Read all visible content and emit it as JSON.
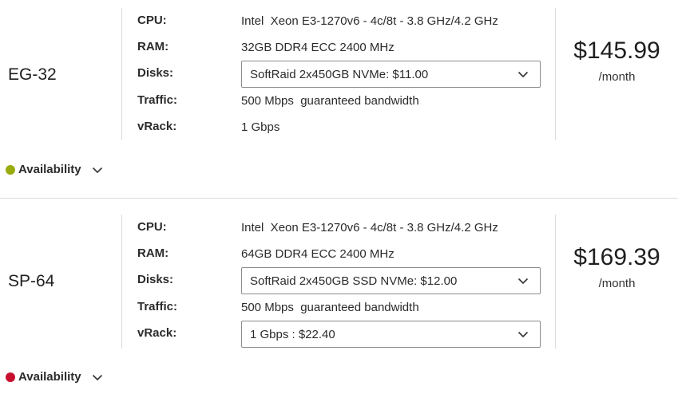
{
  "servers": [
    {
      "name": "EG-32",
      "specs": {
        "cpu_label": "CPU:",
        "cpu_value": "Intel  Xeon E3-1270v6 - 4c/8t - 3.8 GHz/4.2 GHz",
        "ram_label": "RAM:",
        "ram_value": "32GB DDR4 ECC 2400 MHz",
        "disks_label": "Disks:",
        "disks_selected": "SoftRaid 2x450GB NVMe: $11.00",
        "traffic_label": "Traffic:",
        "traffic_value": "500 Mbps  guaranteed bandwidth",
        "vrack_label": "vRack:",
        "vrack_value": "1 Gbps"
      },
      "price": "$145.99",
      "period": "/month",
      "availability_label": "Availability",
      "availability_color": "#9aab0e"
    },
    {
      "name": "SP-64",
      "specs": {
        "cpu_label": "CPU:",
        "cpu_value": "Intel  Xeon E3-1270v6 - 4c/8t - 3.8 GHz/4.2 GHz",
        "ram_label": "RAM:",
        "ram_value": "64GB DDR4 ECC 2400 MHz",
        "disks_label": "Disks:",
        "disks_selected": "SoftRaid 2x450GB SSD NVMe: $12.00",
        "traffic_label": "Traffic:",
        "traffic_value": "500 Mbps  guaranteed bandwidth",
        "vrack_label": "vRack:",
        "vrack_selected": "1 Gbps : $22.40"
      },
      "price": "$169.39",
      "period": "/month",
      "availability_label": "Availability",
      "availability_color": "#c8102e"
    }
  ],
  "icons": {
    "dropdown": "chevron-down-icon",
    "availability_toggle": "chevron-down-icon",
    "availability_status": "status-dot-icon"
  }
}
